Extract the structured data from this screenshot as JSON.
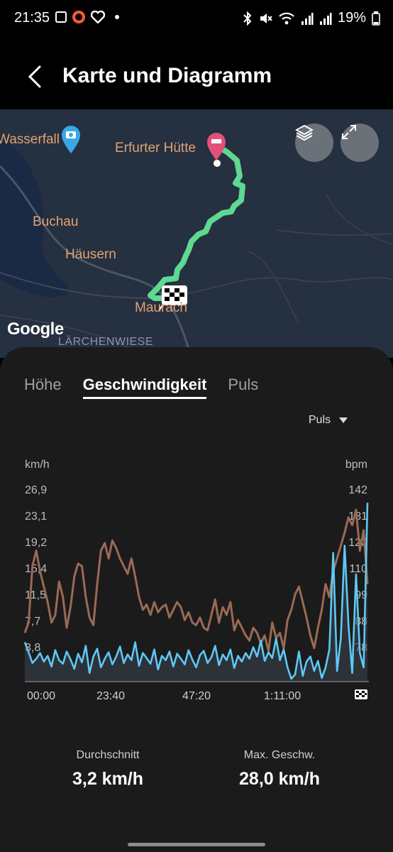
{
  "status_bar": {
    "time": "21:35",
    "battery": "19%",
    "icons": [
      "gallery-icon",
      "record-icon",
      "health-icon",
      "dot-icon",
      "bluetooth-icon",
      "mute-icon",
      "wifi-icon",
      "signal-icon",
      "signal-icon",
      "battery-icon"
    ]
  },
  "header": {
    "title": "Karte und Diagramm",
    "back_icon": "chevron-left-icon"
  },
  "map": {
    "labels": {
      "wasserfall": "Wasserfall",
      "erfurter": "Erfurter Hütte",
      "buchau": "Buchau",
      "haeusern": "Häusern",
      "maurach": "Maurach",
      "laerchenwiese": "LÄRCHENWIESE"
    },
    "attribution": "Google",
    "buttons": [
      "layers-icon",
      "expand-icon"
    ],
    "route_color": "#5fd890",
    "pin_color": "#e2507b",
    "camera_pin_color": "#3aa8e6"
  },
  "tabs": [
    {
      "label": "Höhe",
      "active": false
    },
    {
      "label": "Geschwindigkeit",
      "active": true
    },
    {
      "label": "Puls",
      "active": false
    }
  ],
  "overlay_select": {
    "value": "Puls"
  },
  "chart_data": {
    "type": "line",
    "left_unit": "km/h",
    "right_unit": "bpm",
    "left_ticks": [
      "26,9",
      "23,1",
      "19,2",
      "15,4",
      "11,5",
      "7,7",
      "3,8"
    ],
    "right_ticks": [
      "142",
      "131",
      "120",
      "110",
      "99",
      "88",
      "78"
    ],
    "x_ticks": [
      "00:00",
      "23:40",
      "47:20",
      "1:11:00"
    ],
    "ylim_speed": [
      0,
      26.9
    ],
    "ylim_hr": [
      67,
      142
    ],
    "series": [
      {
        "name": "Geschwindigkeit",
        "color": "#5ec8f5",
        "x": [
          0,
          1,
          2,
          3,
          4,
          5,
          6,
          7,
          8,
          9,
          10,
          11,
          12,
          13,
          14,
          15,
          16,
          17,
          18,
          19,
          20,
          21,
          22,
          23,
          24,
          25,
          26,
          27,
          28,
          29,
          30,
          31,
          32,
          33,
          34,
          35,
          36,
          37,
          38,
          39,
          40,
          41,
          42,
          43,
          44,
          45,
          46,
          47,
          48,
          49,
          50,
          51,
          52,
          53,
          54,
          55,
          56,
          57,
          58,
          59,
          60,
          61,
          62,
          63,
          64,
          65,
          66,
          67,
          68,
          69,
          70,
          71,
          72,
          73,
          74,
          75,
          76,
          77,
          78,
          79,
          80,
          81,
          82,
          83,
          84,
          85,
          86,
          87,
          88,
          89,
          90
        ],
        "values": [
          5.5,
          4.1,
          2.6,
          3.2,
          4.0,
          2.8,
          3.6,
          2.1,
          4.4,
          3.0,
          2.5,
          4.2,
          3.1,
          1.8,
          3.9,
          2.7,
          5.0,
          1.2,
          3.5,
          4.6,
          2.0,
          3.2,
          4.1,
          2.4,
          3.5,
          4.9,
          2.6,
          3.8,
          3.0,
          5.5,
          2.2,
          4.0,
          3.3,
          2.5,
          4.5,
          1.7,
          3.6,
          3.0,
          4.2,
          2.1,
          3.9,
          3.2,
          2.4,
          4.4,
          3.1,
          2.0,
          3.7,
          4.3,
          2.6,
          3.4,
          5.0,
          2.3,
          3.8,
          3.0,
          4.5,
          1.9,
          3.6,
          2.8,
          4.0,
          3.2,
          4.8,
          3.5,
          5.7,
          2.9,
          4.1,
          3.3,
          6.0,
          3.0,
          4.5,
          2.0,
          0.4,
          1.0,
          4.2,
          0.8,
          2.8,
          3.5,
          1.5,
          2.9,
          0.5,
          2.0,
          4.5,
          18.0,
          1.5,
          6.0,
          19.0,
          8.0,
          1.2,
          15.0,
          4.0,
          2.0,
          25.0
        ]
      },
      {
        "name": "Puls",
        "color": "#9a6a55",
        "x": [
          0,
          1,
          2,
          3,
          4,
          5,
          6,
          7,
          8,
          9,
          10,
          11,
          12,
          13,
          14,
          15,
          16,
          17,
          18,
          19,
          20,
          21,
          22,
          23,
          24,
          25,
          26,
          27,
          28,
          29,
          30,
          31,
          32,
          33,
          34,
          35,
          36,
          37,
          38,
          39,
          40,
          41,
          42,
          43,
          44,
          45,
          46,
          47,
          48,
          49,
          50,
          51,
          52,
          53,
          54,
          55,
          56,
          57,
          58,
          59,
          60,
          61,
          62,
          63,
          64,
          65,
          66,
          67,
          68,
          69,
          70,
          71,
          72,
          73,
          74,
          75,
          76,
          77,
          78,
          79,
          80,
          81,
          82,
          83,
          84,
          85,
          86,
          87,
          88,
          89,
          90
        ],
        "values": [
          86,
          90,
          112,
          118,
          110,
          104,
          98,
          90,
          93,
          106,
          100,
          88,
          96,
          108,
          113,
          112,
          100,
          92,
          89,
          105,
          118,
          121,
          115,
          122,
          119,
          115,
          112,
          109,
          115,
          108,
          100,
          95,
          97,
          93,
          98,
          94,
          96,
          97,
          92,
          95,
          98,
          96,
          91,
          94,
          90,
          89,
          92,
          88,
          87,
          93,
          99,
          90,
          96,
          93,
          98,
          87,
          91,
          88,
          85,
          83,
          88,
          86,
          82,
          85,
          79,
          90,
          84,
          86,
          80,
          91,
          95,
          101,
          104,
          98,
          92,
          85,
          80,
          88,
          95,
          105,
          100,
          110,
          115,
          120,
          125,
          131,
          128,
          134,
          118,
          126,
          105
        ]
      }
    ]
  },
  "stats": {
    "avg_label": "Durchschnitt",
    "avg_value": "3,2 km/h",
    "max_label": "Max. Geschw.",
    "max_value": "28,0 km/h"
  }
}
